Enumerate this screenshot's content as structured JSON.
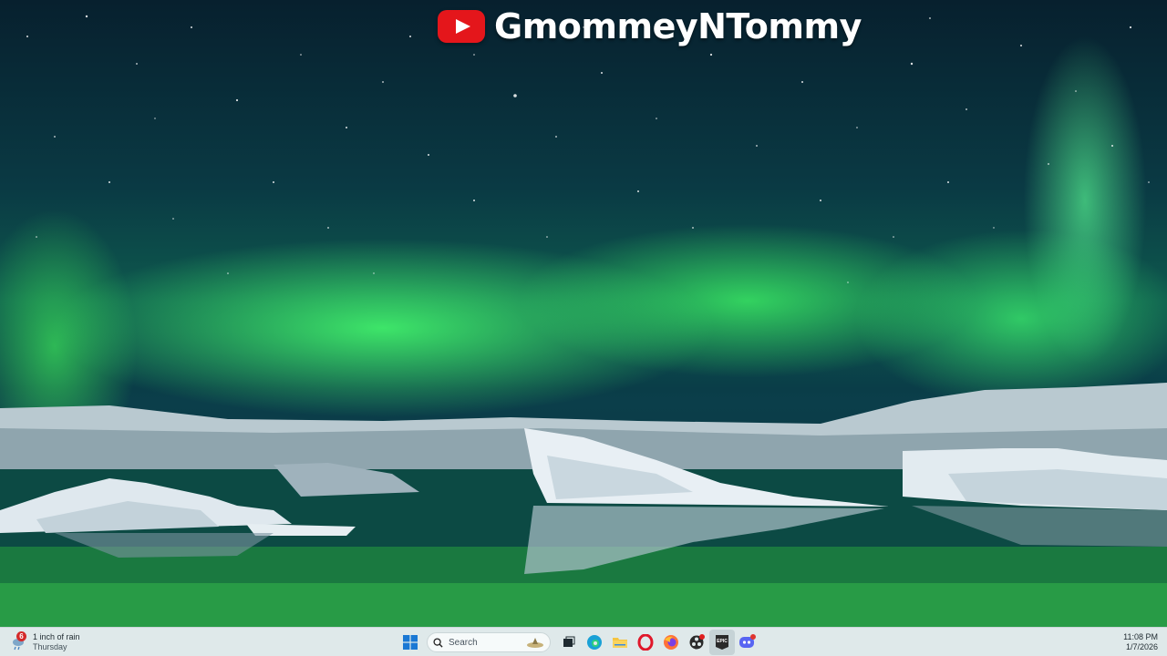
{
  "channel": {
    "name": "GmommeyNTommy",
    "logo_icon": "youtube-logo-icon",
    "logo_color": "#e4161b"
  },
  "taskbar": {
    "weather": {
      "badge_count": "6",
      "line1": "1 inch of rain",
      "line2": "Thursday",
      "icon": "rain-cloud-icon"
    },
    "search": {
      "placeholder": "Search"
    },
    "apps": [
      {
        "name": "start",
        "icon": "windows-start-icon"
      },
      {
        "name": "task-view",
        "icon": "task-view-icon"
      },
      {
        "name": "edge",
        "icon": "edge-browser-icon"
      },
      {
        "name": "file-explorer",
        "icon": "folder-icon"
      },
      {
        "name": "opera",
        "icon": "opera-browser-icon"
      },
      {
        "name": "firefox",
        "icon": "firefox-icon"
      },
      {
        "name": "obs",
        "icon": "obs-record-icon"
      },
      {
        "name": "epic-games",
        "icon": "epic-games-icon",
        "label": "EPIC"
      },
      {
        "name": "discord",
        "icon": "discord-icon",
        "badge": "9+"
      }
    ],
    "clock": {
      "time": "11:08 PM",
      "date": "1/7/2026"
    }
  }
}
